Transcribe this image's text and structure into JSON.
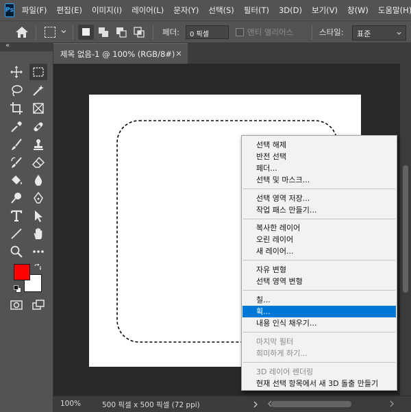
{
  "app": {
    "logo_text": "Ps"
  },
  "menubar": {
    "items": [
      "파일(F)",
      "편집(E)",
      "이미지(I)",
      "레이어(L)",
      "문자(Y)",
      "선택(S)",
      "필터(T)",
      "3D(D)",
      "보기(V)",
      "창(W)",
      "도움말(H)"
    ]
  },
  "options": {
    "feather_label": "페더:",
    "feather_value": "0 픽셀",
    "antialias_label": "앤티 앨리어스",
    "style_label": "스타일:",
    "style_value": "표준"
  },
  "document": {
    "tab_title": "제목 없음-1 @ 100% (RGB/8#)"
  },
  "colors": {
    "foreground": "#ff0000",
    "background": "#ffffff",
    "highlight": "#0078d7"
  },
  "status": {
    "zoom": "100%",
    "doc_size": "500 픽셀 x 500 픽셀 (72 ppi)"
  },
  "context_menu": {
    "items": [
      {
        "label": "선택 해제",
        "enabled": true
      },
      {
        "label": "반전 선택",
        "enabled": true
      },
      {
        "label": "페더...",
        "enabled": true
      },
      {
        "label": "선택 및 마스크...",
        "enabled": true
      },
      {
        "label": "선택 영역 저장...",
        "enabled": true
      },
      {
        "label": "작업 패스 만들기...",
        "enabled": true
      },
      {
        "label": "복사한 레이어",
        "enabled": true
      },
      {
        "label": "오린 레이어",
        "enabled": true
      },
      {
        "label": "새 레이어...",
        "enabled": true
      },
      {
        "label": "자유 변형",
        "enabled": true
      },
      {
        "label": "선택 영역 변형",
        "enabled": true
      },
      {
        "label": "칠...",
        "enabled": true
      },
      {
        "label": "획...",
        "enabled": true,
        "highlighted": true
      },
      {
        "label": "내용 인식 채우기...",
        "enabled": true
      },
      {
        "label": "마지막 필터",
        "enabled": false
      },
      {
        "label": "희미하게 하기...",
        "enabled": false
      },
      {
        "label": "3D 레이어 렌더링",
        "enabled": false
      },
      {
        "label": "현재 선택 항목에서 새 3D 돌출 만들기",
        "enabled": true
      }
    ]
  }
}
